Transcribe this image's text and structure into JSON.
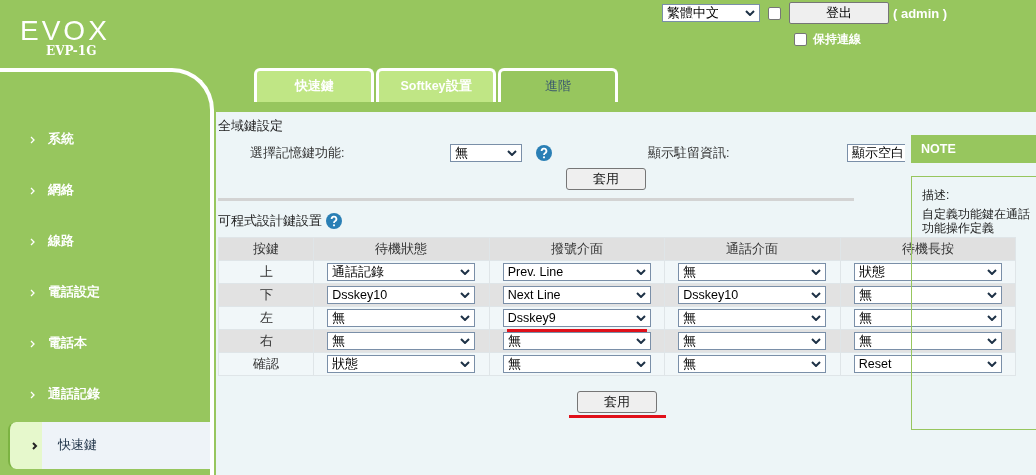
{
  "header": {
    "logo": "EVOX",
    "model": "EVP-1G",
    "language": "繁體中文",
    "option_checked": false,
    "logout_button": "登出",
    "user": "( admin )",
    "keep_connected": {
      "label": "保持連線",
      "checked": false
    }
  },
  "sidebar": {
    "items": [
      {
        "label": "系統",
        "selected": false
      },
      {
        "label": "網絡",
        "selected": false
      },
      {
        "label": "線路",
        "selected": false
      },
      {
        "label": "電話設定",
        "selected": false
      },
      {
        "label": "電話本",
        "selected": false
      },
      {
        "label": "通話記錄",
        "selected": false
      },
      {
        "label": "快速鍵",
        "selected": true
      }
    ]
  },
  "tabs": [
    {
      "label": "快速鍵",
      "selected": false
    },
    {
      "label": "Softkey設置",
      "selected": false
    },
    {
      "label": "進階",
      "selected": true
    }
  ],
  "global_keys": {
    "title": "全域鍵設定",
    "fields": [
      {
        "label": "選擇記憶鍵功能:",
        "value": "無",
        "help": true
      },
      {
        "label": "顯示駐留資訊:",
        "value": "顯示空白",
        "help": false
      }
    ],
    "apply_button": "套用"
  },
  "programmable_keys": {
    "title": "可程式設計鍵設置",
    "help": true,
    "columns": [
      "按鍵",
      "待機狀態",
      "撥號介面",
      "通話介面",
      "待機長按"
    ],
    "rows": [
      {
        "cells": [
          {
            "kind": "text",
            "value": "上"
          },
          {
            "kind": "dropdown",
            "value": "通話記錄",
            "underlined": false
          },
          {
            "kind": "dropdown",
            "value": "Prev. Line",
            "underlined": false
          },
          {
            "kind": "dropdown",
            "value": "無",
            "underlined": false
          },
          {
            "kind": "dropdown",
            "value": "狀態",
            "underlined": false
          }
        ]
      },
      {
        "cells": [
          {
            "kind": "text",
            "value": "下"
          },
          {
            "kind": "dropdown",
            "value": "Dsskey10",
            "underlined": false
          },
          {
            "kind": "dropdown",
            "value": "Next Line",
            "underlined": false
          },
          {
            "kind": "dropdown",
            "value": "Dsskey10",
            "underlined": false
          },
          {
            "kind": "dropdown",
            "value": "無",
            "underlined": false
          }
        ]
      },
      {
        "cells": [
          {
            "kind": "text",
            "value": "左"
          },
          {
            "kind": "dropdown",
            "value": "無",
            "underlined": false
          },
          {
            "kind": "dropdown",
            "value": "Dsskey9",
            "underlined": true
          },
          {
            "kind": "dropdown",
            "value": "無",
            "underlined": false
          },
          {
            "kind": "dropdown",
            "value": "無",
            "underlined": false
          }
        ]
      },
      {
        "cells": [
          {
            "kind": "text",
            "value": "右"
          },
          {
            "kind": "dropdown",
            "value": "無",
            "underlined": false
          },
          {
            "kind": "dropdown",
            "value": "無",
            "underlined": false
          },
          {
            "kind": "dropdown",
            "value": "無",
            "underlined": false
          },
          {
            "kind": "dropdown",
            "value": "無",
            "underlined": false
          }
        ]
      },
      {
        "cells": [
          {
            "kind": "text",
            "value": "確認"
          },
          {
            "kind": "dropdown",
            "value": "狀態",
            "underlined": false
          },
          {
            "kind": "dropdown",
            "value": "無",
            "underlined": false
          },
          {
            "kind": "dropdown",
            "value": "無",
            "underlined": false
          },
          {
            "kind": "dropdown",
            "value": "Reset",
            "underlined": false
          }
        ]
      }
    ],
    "apply_button": {
      "label": "套用",
      "underlined": true
    }
  },
  "note": {
    "title": "NOTE",
    "heading": "描述:",
    "lines": [
      "自定義功能鍵在通話",
      "功能操作定義"
    ]
  }
}
